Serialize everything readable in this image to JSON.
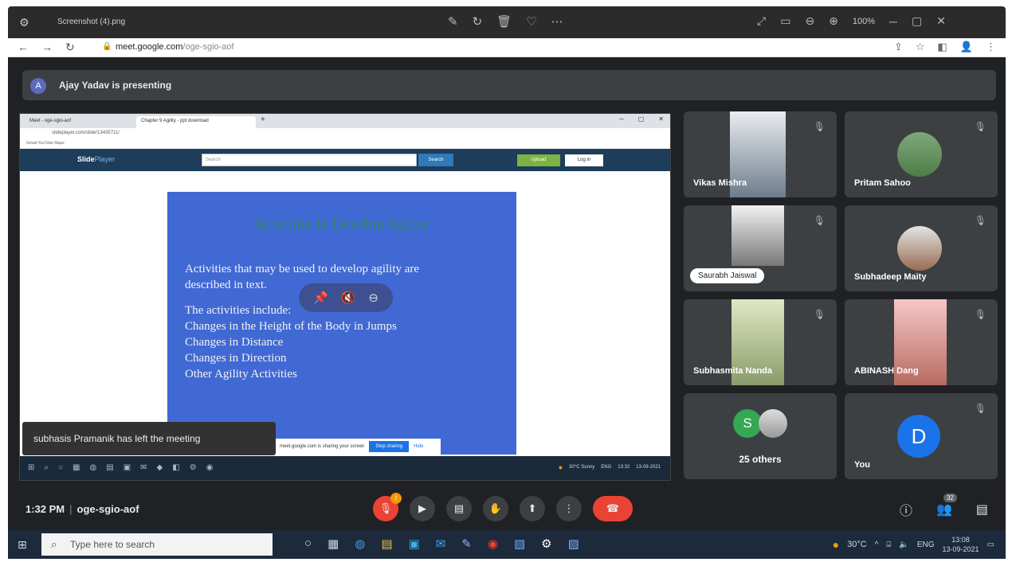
{
  "viewer": {
    "file_name": "Screenshot (4).png",
    "zoom": "100%"
  },
  "browser": {
    "url_host": "meet.google.com",
    "url_path": "/oge-sgio-aof"
  },
  "meet": {
    "presenting_initial": "A",
    "presenting_text": "Ajay Yadav is presenting",
    "toast": "subhasis Pramanik has left the meeting",
    "clock": "1:32 PM",
    "meeting_code": "oge-sgio-aof",
    "people_count": "32"
  },
  "shared": {
    "tab1": "Meet - oge-sgio-aof",
    "tab2": "Chapter 9 Agility - ppt download",
    "url": "slideplayer.com/slide/13435711/",
    "bookmarks": "Gmail   YouTube   Maps",
    "logo_main": "Slide",
    "logo_sub": "Player",
    "search_placeholder": "Search",
    "search_btn": "Search",
    "upload_btn": "Upload",
    "login_btn": "Log in",
    "share_notice": "meet.google.com is sharing your screen",
    "stop_sharing": "Stop sharing",
    "hide": "Hide",
    "weather": "30°C  Sunny",
    "lang": "ENG",
    "time": "13:32",
    "date": "13-09-2021"
  },
  "slide": {
    "title": "Activities to Develop Agility",
    "line1": "Activities that may be used to develop agility are",
    "line2": "described in text.",
    "line3": "The activities include:",
    "items": [
      "Changes in the Height of the Body in Jumps",
      "Changes in Distance",
      "Changes in Direction",
      "Other Agility Activities"
    ]
  },
  "participants": {
    "p1": "Vikas Mishra",
    "p2": "Pritam Sahoo",
    "p3": "Saurabh Jaiswal",
    "p4": "Subhadeep Maity",
    "p5": "Subhasmita Nanda",
    "p6": "ABINASH Dang",
    "others_initial": "S",
    "others": "25 others",
    "you_initial": "D",
    "you": "You"
  },
  "taskbar": {
    "search_placeholder": "Type here to search",
    "temp": "30°C",
    "lang": "ENG",
    "time": "13:08",
    "date": "13-09-2021"
  }
}
